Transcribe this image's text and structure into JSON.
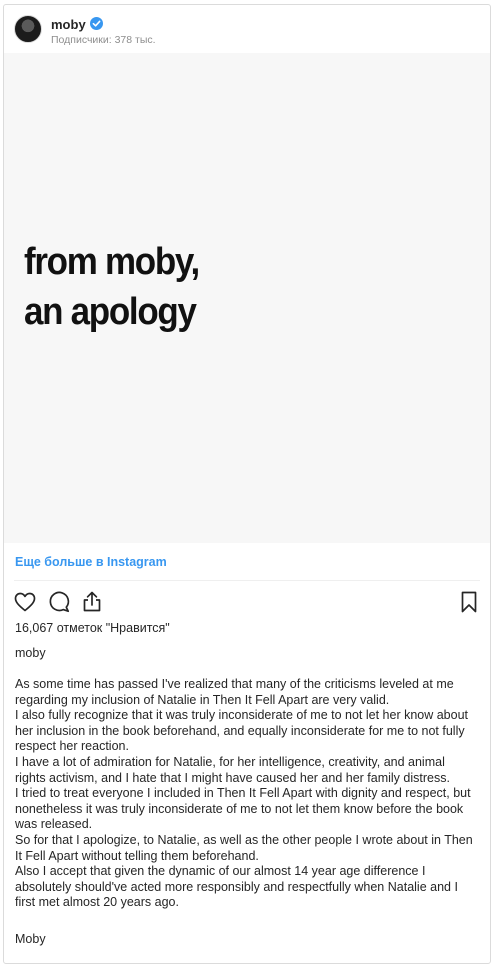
{
  "post": {
    "username": "moby",
    "followers": "Подписчики: 378 тыс.",
    "image_headline": [
      "from moby,",
      "an apology"
    ],
    "more_link": "Еще больше в Instagram",
    "likes": "16,067 отметок \"Нравится\"",
    "caption_author": "moby",
    "caption_lines": [
      "As some time has passed I've realized that many of the criticisms leveled at me",
      "regarding my inclusion of Natalie in Then It Fell Apart are very valid.",
      "I also fully recognize that it was truly inconsiderate of me to not let her know about",
      "her inclusion in the book beforehand, and equally inconsiderate for me to not fully",
      "respect her reaction.",
      "I have a lot of admiration for Natalie, for her intelligence, creativity, and animal",
      "rights activism, and I hate that I might have caused her and her family distress.",
      "I tried to treat everyone I included in Then It Fell Apart with dignity and respect, but",
      "nonetheless it was truly inconsiderate of me to not let them know before the book",
      "was released.",
      "So for that I apologize, to Natalie, as well as the other people I wrote about in Then",
      "It Fell Apart without telling them beforehand.",
      "Also I accept that given the dynamic of our almost 14 year age difference I",
      "absolutely should've acted more responsibly and respectfully when Natalie and I",
      "first met almost 20 years ago."
    ],
    "signoff": "Moby"
  },
  "icons": {
    "verified": "verified-badge-icon",
    "like": "heart-icon",
    "comment": "comment-icon",
    "share": "share-icon",
    "save": "bookmark-icon"
  },
  "colors": {
    "link": "#3897f0",
    "verified": "#3897f0",
    "border": "#dbdbdb",
    "muted": "#8e8e8e"
  }
}
